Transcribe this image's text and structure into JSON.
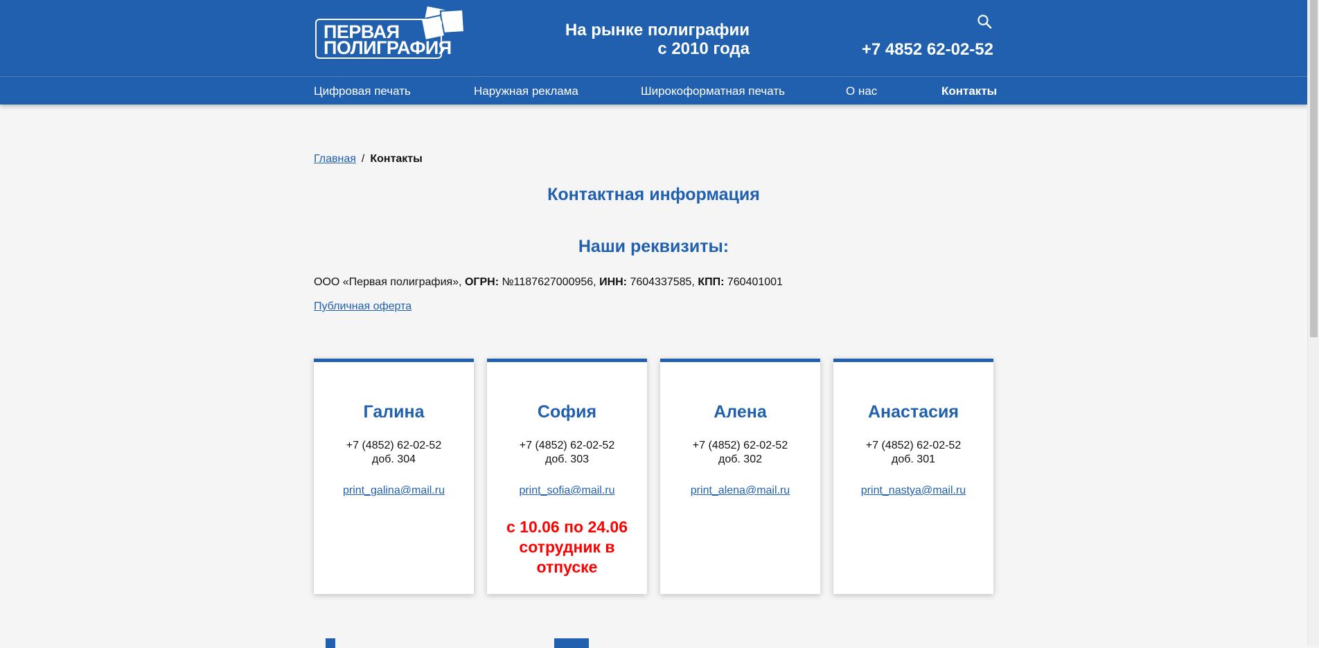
{
  "header": {
    "logo_line1": "ПЕРВАЯ",
    "logo_line2": "ПОЛИГРАФИЯ",
    "tagline_line1": "На рынке полиграфии",
    "tagline_line2": "с 2010 года",
    "phone": "+7 4852 62-02-52",
    "search_icon": "search-icon",
    "colors": {
      "brand": "#2160ae",
      "text_on_brand": "#ffffff",
      "alert": "#ff0000"
    }
  },
  "nav": {
    "items": [
      {
        "label": "Цифровая печать"
      },
      {
        "label": "Наружная реклама"
      },
      {
        "label": "Широкоформатная печать"
      },
      {
        "label": "О нас"
      },
      {
        "label": "Контакты"
      }
    ]
  },
  "breadcrumb": {
    "home": "Главная",
    "separator": "/",
    "current": "Контакты"
  },
  "page": {
    "title": "Контактная информация",
    "requisites_title": "Наши реквизиты:",
    "requisites": {
      "company": "ООО «Первая полиграфия», ",
      "ogrn_label": "ОГРН:",
      "ogrn_value": " №1187627000956, ",
      "inn_label": "ИНН:",
      "inn_value": " 7604337585, ",
      "kpp_label": "КПП:",
      "kpp_value": " 760401001"
    },
    "offer_link": "Публичная оферта"
  },
  "contacts": [
    {
      "name": "Галина",
      "phone": "+7 (4852) 62-02-52",
      "ext": "доб. 304",
      "email": "print_galina@mail.ru",
      "note": ""
    },
    {
      "name": "София",
      "phone": "+7 (4852) 62-02-52",
      "ext": "доб. 303",
      "email": "print_sofia@mail.ru",
      "note": "с 10.06 по 24.06 сотрудник в отпуске"
    },
    {
      "name": "Алена",
      "phone": "+7 (4852) 62-02-52",
      "ext": "доб. 302",
      "email": "print_alena@mail.ru",
      "note": ""
    },
    {
      "name": "Анастасия",
      "phone": "+7 (4852) 62-02-52",
      "ext": "доб. 301",
      "email": "print_nastya@mail.ru",
      "note": ""
    }
  ]
}
